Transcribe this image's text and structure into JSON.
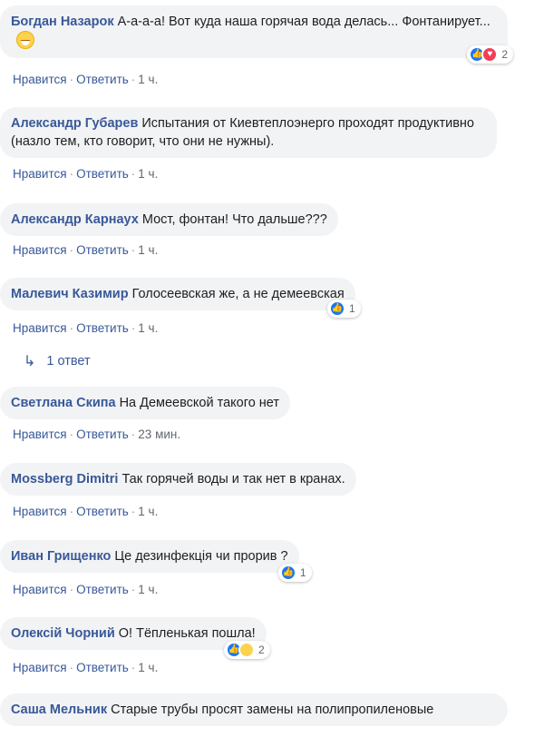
{
  "comments": [
    {
      "author": "Богдан Назарок",
      "text": "А-а-а-а! Вот куда наша горячая вода делась... Фонтанирует...",
      "like": "Нравится",
      "reply": "Ответить",
      "time": "1 ч.",
      "reactions": {
        "types": [
          "like",
          "love"
        ],
        "count": "2"
      }
    },
    {
      "author": "Александр Губарев",
      "text": "Испытания от Киевтеплоэнерго проходят продуктивно (назло тем, кто говорит, что они не нужны).",
      "like": "Нравится",
      "reply": "Ответить",
      "time": "1 ч."
    },
    {
      "author": "Александр Карнаух",
      "text": "Мост, фонтан! Что дальше???",
      "like": "Нравится",
      "reply": "Ответить",
      "time": "1 ч."
    },
    {
      "author": "Малевич Казимир",
      "text": "Голосеевская же, а не демеевская",
      "like": "Нравится",
      "reply": "Ответить",
      "time": "1 ч.",
      "reactions": {
        "types": [
          "like"
        ],
        "count": "1"
      }
    },
    {
      "author": "Светлана Скипа",
      "text": "На Демеевской такого нет",
      "like": "Нравится",
      "reply": "Ответить",
      "time": "23 мин."
    },
    {
      "author": "Mossberg Dimitri",
      "text": "Так горячей воды и так нет в кранах.",
      "like": "Нравится",
      "reply": "Ответить",
      "time": "1 ч."
    },
    {
      "author": "Иван Грищенко",
      "text": "Це дезинфекція чи прорив ?",
      "like": "Нравится",
      "reply": "Ответить",
      "time": "1 ч.",
      "reactions": {
        "types": [
          "like"
        ],
        "count": "1"
      }
    },
    {
      "author": "Олексій Чорний",
      "text": "О! Тёпленькая пошла!",
      "like": "Нравится",
      "reply": "Ответить",
      "time": "1 ч.",
      "reactions": {
        "types": [
          "like",
          "haha"
        ],
        "count": "2"
      }
    },
    {
      "author": "Саша Мельник",
      "text": "Старые трубы просят замены на полипропиленовые"
    }
  ],
  "replies_link": "1 ответ",
  "separator": "·",
  "colors": {
    "author": "#385898",
    "bubble": "#f2f3f5",
    "meta": "#616770",
    "like": "#1877f2",
    "love": "#f33e58",
    "haha": "#fcd34d"
  }
}
